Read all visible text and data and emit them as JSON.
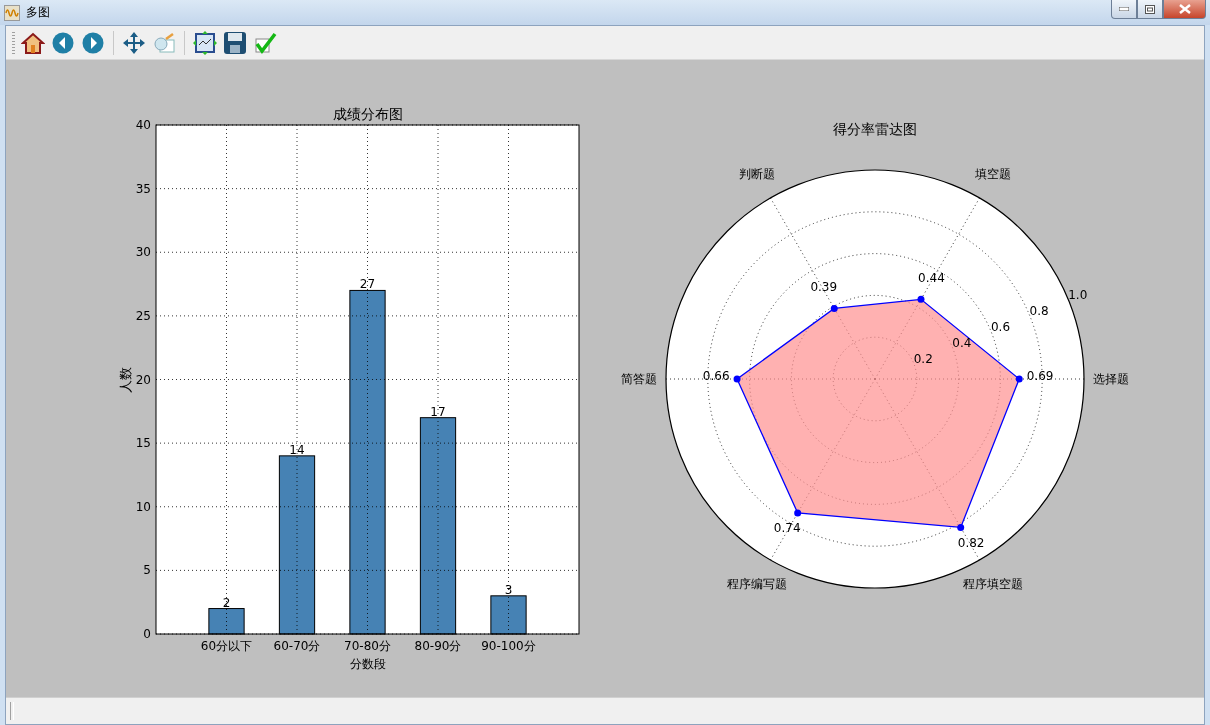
{
  "window": {
    "title": "多图"
  },
  "bar_chart": {
    "chart_data": {
      "type": "bar",
      "title": "成绩分布图",
      "xlabel": "分数段",
      "ylabel": "人数",
      "categories": [
        "60分以下",
        "60-70分",
        "70-80分",
        "80-90分",
        "90-100分"
      ],
      "values": [
        2,
        14,
        27,
        17,
        3
      ],
      "ylim": [
        0,
        40
      ],
      "yticks": [
        0,
        5,
        10,
        15,
        20,
        25,
        30,
        35,
        40
      ],
      "data_labels": true,
      "grid": true
    }
  },
  "radar_chart": {
    "title": "得分率雷达图",
    "rings": [
      "0.2",
      "0.4",
      "0.6",
      "0.8",
      "1.0"
    ],
    "axes": [
      {
        "label": "判断题",
        "score": "0.39"
      },
      {
        "label": "填空题",
        "score": "0.44"
      },
      {
        "label": "简答题",
        "score": "0.66"
      },
      {
        "label": "选择题",
        "score": "0.69"
      },
      {
        "label": "程序编写题",
        "score": "0.74"
      },
      {
        "label": "程序填空题",
        "score": "0.82"
      }
    ]
  }
}
